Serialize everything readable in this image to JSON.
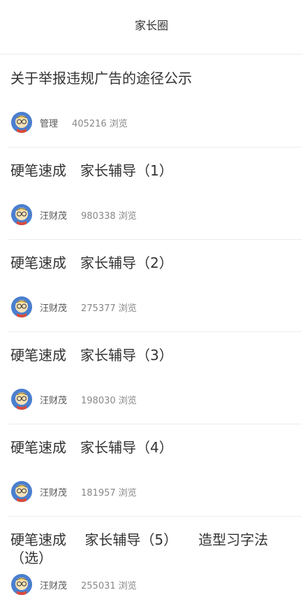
{
  "header": {
    "title": "家长圈"
  },
  "posts": [
    {
      "title": "关于举报违规广告的途径公示",
      "author": "管理",
      "views": "405216 浏览"
    },
    {
      "title": "硬笔速成　家长辅导（1）",
      "author": "汪财茂",
      "views": "980338 浏览"
    },
    {
      "title": "硬笔速成　家长辅导（2）",
      "author": "汪财茂",
      "views": "275377 浏览"
    },
    {
      "title": "硬笔速成　家长辅导（3）",
      "author": "汪财茂",
      "views": "198030 浏览"
    },
    {
      "title": "硬笔速成　家长辅导（4）",
      "author": "汪财茂",
      "views": "181957 浏览"
    },
    {
      "title": "硬笔速成　 家长辅导（5）　　造型习字法（选）",
      "author": "汪财茂",
      "views": "255031 浏览"
    }
  ]
}
